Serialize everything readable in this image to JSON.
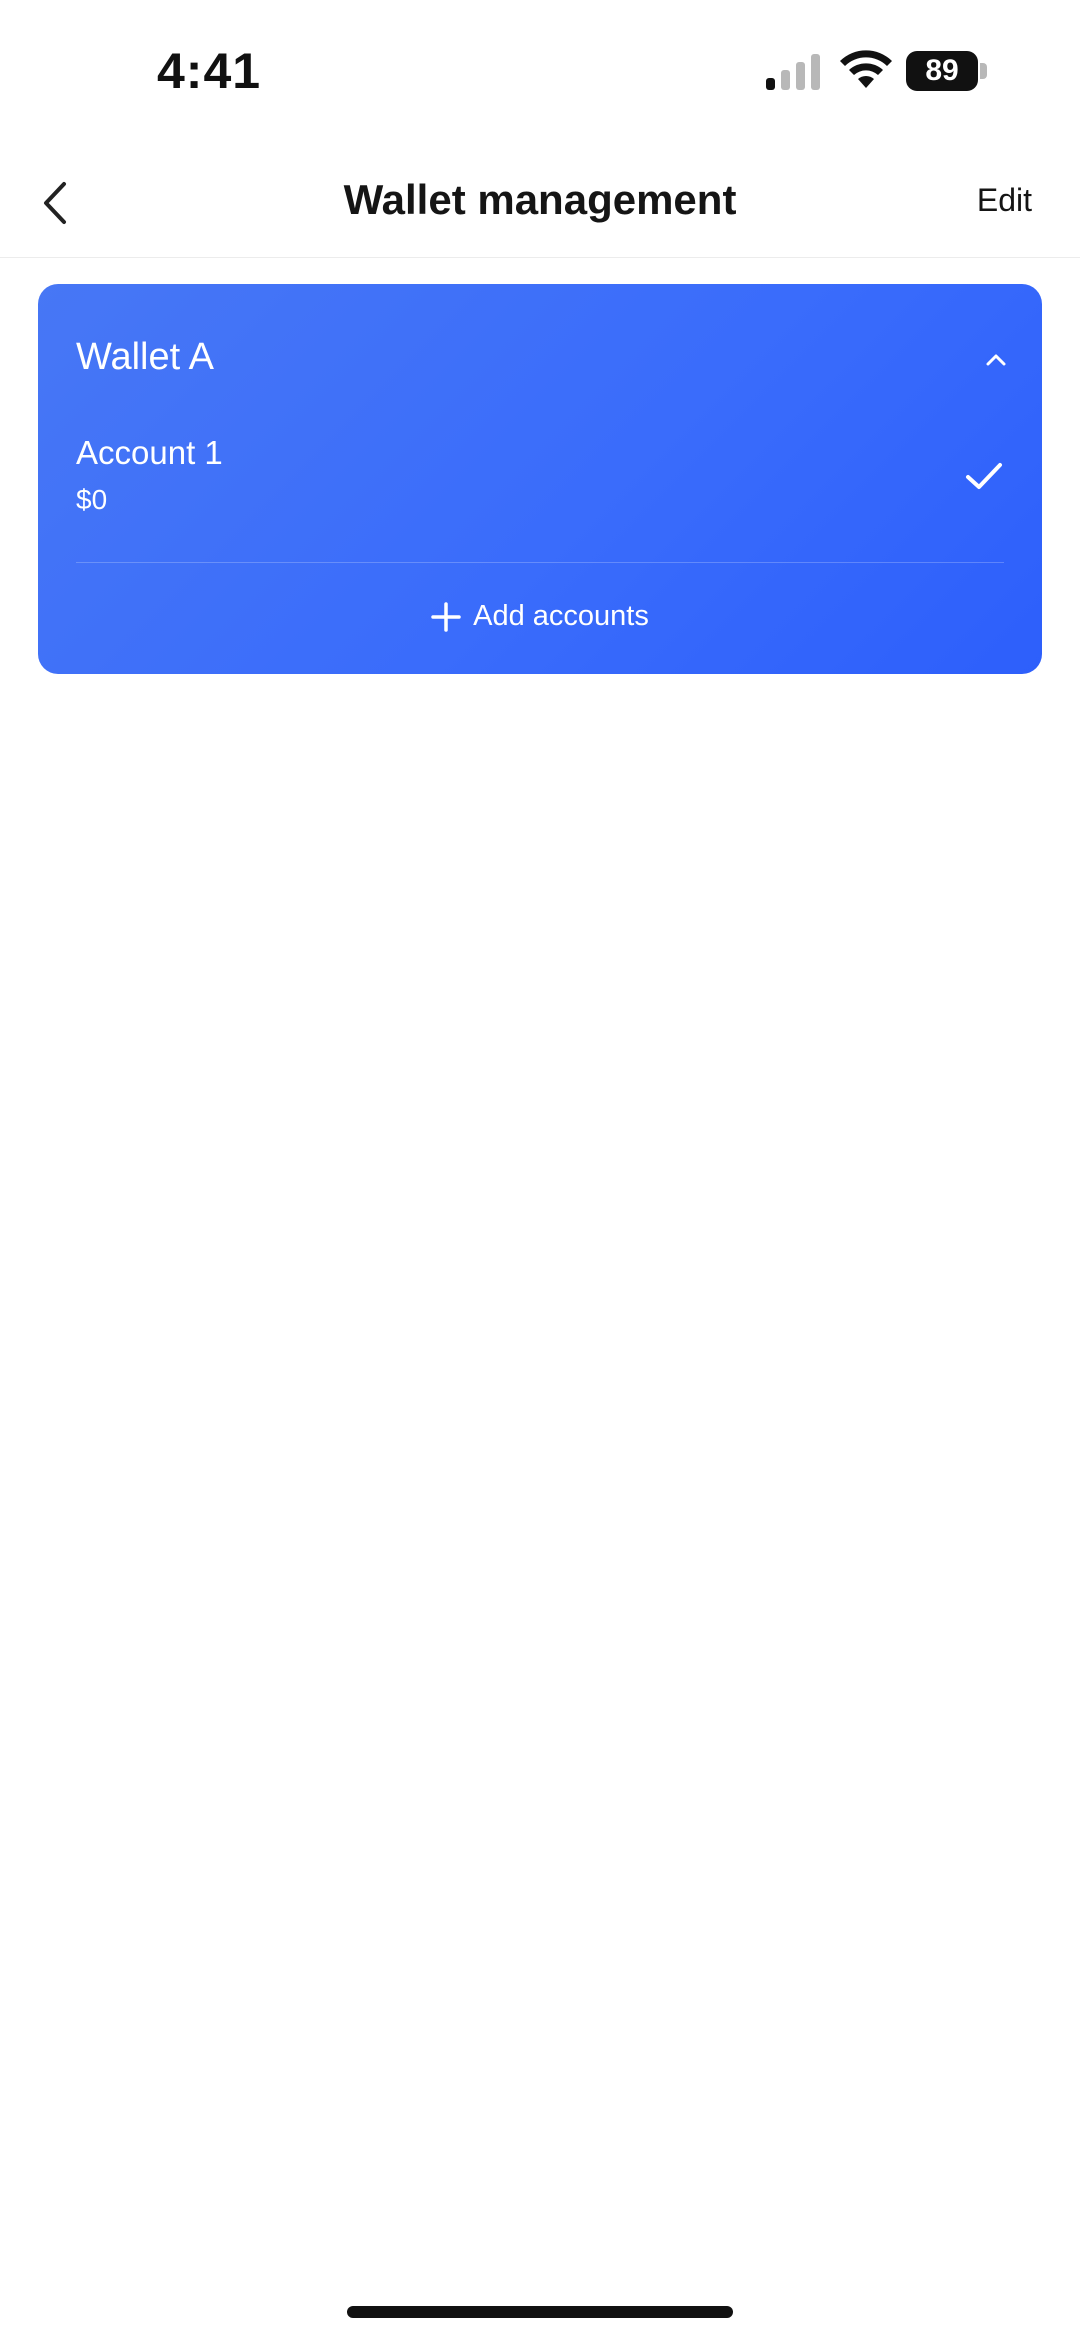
{
  "status_bar": {
    "time": "4:41",
    "battery": "89",
    "icons": [
      "cellular-signal-icon",
      "wifi-icon",
      "battery-icon"
    ]
  },
  "nav": {
    "title": "Wallet management",
    "edit_label": "Edit",
    "back_icon": "chevron-left-icon"
  },
  "wallet": {
    "name": "Wallet A",
    "collapse_icon": "chevron-up-icon",
    "accounts": [
      {
        "name": "Account 1",
        "balance": "$0",
        "selected": true
      }
    ],
    "add_accounts_label": "Add accounts",
    "add_icon": "plus-icon"
  },
  "colors": {
    "card_gradient_start": "#4777f5",
    "card_gradient_end": "#2d5ffb",
    "text_on_card": "#ffffff",
    "title_text": "#151515"
  }
}
